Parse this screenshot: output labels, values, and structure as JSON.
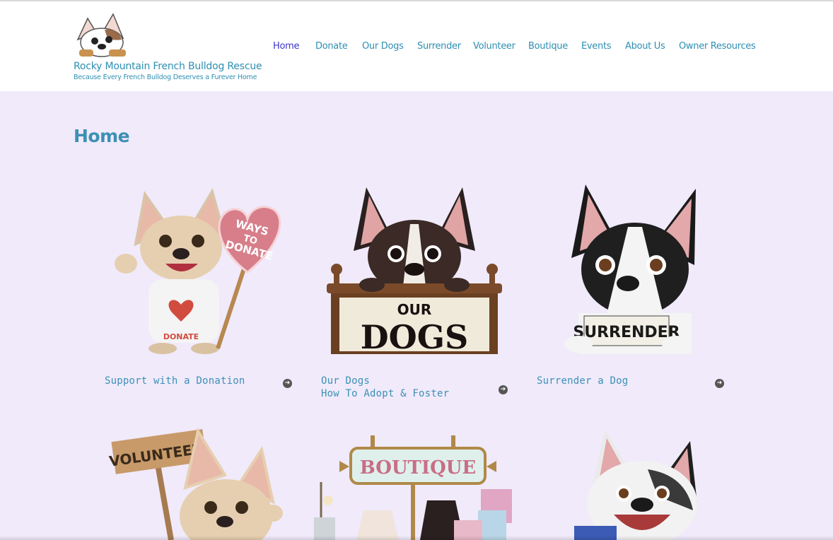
{
  "site": {
    "title": "Rocky Mountain French Bulldog Rescue",
    "tagline": "Because Every French Bulldog Deserves a Furever Home"
  },
  "nav": {
    "items": [
      {
        "label": "Home",
        "active": true
      },
      {
        "label": "Donate"
      },
      {
        "label": "Our Dogs"
      },
      {
        "label": "Surrender"
      },
      {
        "label": "Volunteer"
      },
      {
        "label": "Boutique"
      },
      {
        "label": "Events"
      },
      {
        "label": "About Us"
      },
      {
        "label": "Owner Resources"
      }
    ]
  },
  "page": {
    "title": "Home"
  },
  "cards": [
    {
      "image_text": [
        "WAYS",
        "TO",
        "DONATE"
      ],
      "shirt_text": "DONATE",
      "link": "Support with a Donation"
    },
    {
      "image_text": [
        "OUR",
        "DOGS"
      ],
      "link_lines": [
        "Our Dogs",
        "How To Adopt & Foster"
      ]
    },
    {
      "image_text": [
        "SURRENDER"
      ],
      "link": "Surrender a Dog"
    },
    {
      "image_text": [
        "VOLUNTEER"
      ]
    },
    {
      "image_text": [
        "BOUTIQUE"
      ]
    },
    {
      "image_text": []
    }
  ],
  "colors": {
    "accent": "#3d90b4",
    "active_nav": "#3a35c9",
    "page_bg": "#f0eafb",
    "header_bg": "#ffffff"
  }
}
